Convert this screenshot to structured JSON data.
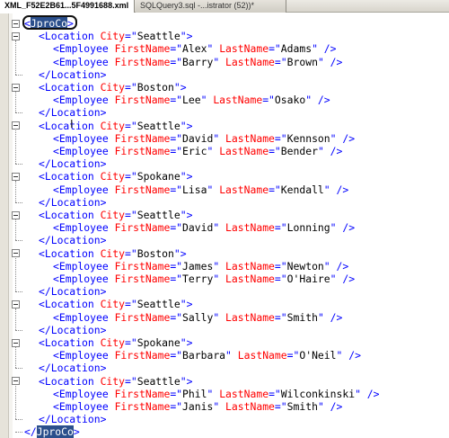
{
  "tabs": [
    {
      "label": "XML_F52E2B61...5F4991688.xml",
      "active": true
    },
    {
      "label": "SQLQuery3.sql -...istrator (52))*",
      "active": false
    }
  ],
  "icons": {
    "close": "close-icon",
    "fold": "collapse-box-icon",
    "cursor": "text-cursor-icon"
  },
  "colors": {
    "tag": "#0000ff",
    "attribute": "#ff0000",
    "value": "#a31515",
    "root_highlight": "#2b4f8c"
  },
  "root": {
    "open_prefix": "<",
    "name": "JproCo",
    "open_suffix": ">",
    "close_prefix": "</",
    "close_suffix": ">"
  },
  "locations": [
    {
      "city": "Seattle",
      "employees": [
        [
          "Alex",
          "Adams"
        ],
        [
          "Barry",
          "Brown"
        ]
      ]
    },
    {
      "city": "Boston",
      "employees": [
        [
          "Lee",
          "Osako"
        ]
      ]
    },
    {
      "city": "Seattle",
      "employees": [
        [
          "David",
          "Kennson"
        ],
        [
          "Eric",
          "Bender"
        ]
      ]
    },
    {
      "city": "Spokane",
      "employees": [
        [
          "Lisa",
          "Kendall"
        ]
      ]
    },
    {
      "city": "Seattle",
      "employees": [
        [
          "David",
          "Lonning"
        ]
      ]
    },
    {
      "city": "Boston",
      "employees": [
        [
          "James",
          "Newton"
        ],
        [
          "Terry",
          "O'Haire"
        ]
      ]
    },
    {
      "city": "Seattle",
      "employees": [
        [
          "Sally",
          "Smith"
        ]
      ]
    },
    {
      "city": "Spokane",
      "employees": [
        [
          "Barbara",
          "O'Neil"
        ]
      ]
    },
    {
      "city": "Seattle",
      "employees": [
        [
          "Phil",
          "Wilconkinski"
        ],
        [
          "Janis",
          "Smith"
        ]
      ]
    }
  ],
  "xml": {
    "location_tag": "Location",
    "employee_tag": "Employee",
    "city_attr": "City",
    "first_attr": "FirstName",
    "last_attr": "LastName",
    "self_close": " />",
    "location_close": "</Location>"
  }
}
